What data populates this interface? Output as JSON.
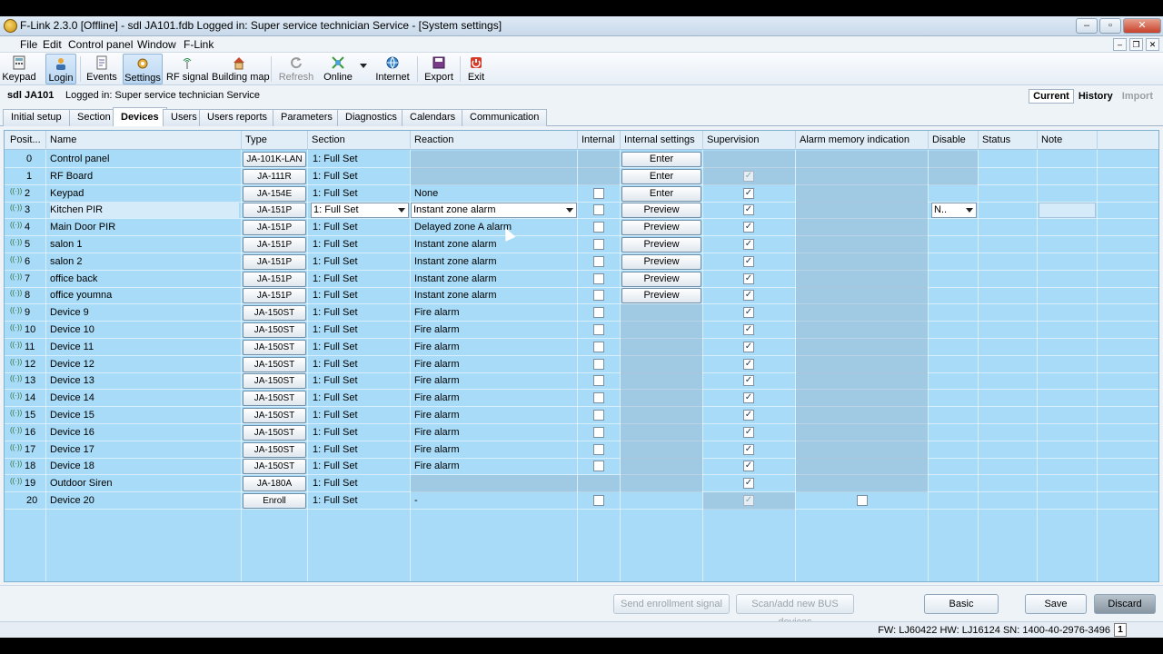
{
  "window": {
    "title": "F-Link 2.3.0 [Offline] - sdl JA101.fdb Logged in: Super service technician Service - [System settings]",
    "min": "–",
    "max": "▫",
    "close": "✕"
  },
  "menu": [
    "File",
    "Edit",
    "Control panel",
    "Window",
    "F-Link"
  ],
  "toolbar": [
    {
      "label": "Keypad",
      "icon": "keypad-icon"
    },
    {
      "label": "Login",
      "icon": "login-icon",
      "active": true
    },
    {
      "label": "Events",
      "icon": "events-icon"
    },
    {
      "label": "Settings",
      "icon": "settings-icon",
      "active": true
    },
    {
      "label": "RF signal",
      "icon": "rf-signal-icon"
    },
    {
      "label": "Building map",
      "icon": "building-map-icon"
    },
    {
      "label": "Refresh",
      "icon": "refresh-icon",
      "disabled": true
    },
    {
      "label": "Online",
      "icon": "online-icon"
    },
    {
      "label": "Internet",
      "icon": "internet-icon"
    },
    {
      "label": "Export",
      "icon": "export-icon"
    },
    {
      "label": "Exit",
      "icon": "exit-icon"
    }
  ],
  "info": {
    "site": "sdl JA101",
    "logged": "Logged in: Super service technician Service"
  },
  "view_tabs": [
    {
      "label": "Current",
      "state": "selected"
    },
    {
      "label": "History",
      "state": "normal"
    },
    {
      "label": "Import",
      "state": "disabled"
    }
  ],
  "tabs": [
    "Initial setup",
    "Section",
    "Devices",
    "Users",
    "Users reports",
    "Parameters",
    "Diagnostics",
    "Calendars",
    "Communication"
  ],
  "selected_tab": "Devices",
  "columns": [
    "Posit...",
    "Name",
    "Type",
    "Section",
    "Reaction",
    "Internal",
    "Internal settings",
    "Supervision",
    "Alarm memory indication",
    "Disable",
    "Status",
    "Note"
  ],
  "rows": [
    {
      "pos": "0",
      "name": "Control panel",
      "type": "JA-101K-LAN",
      "section": "1: Full Set",
      "reaction": "",
      "internal": "",
      "settings": "Enter",
      "supervision": "",
      "memory": "",
      "disable": "",
      "signal": false
    },
    {
      "pos": "1",
      "name": "RF Board",
      "type": "JA-111R",
      "section": "1: Full Set",
      "reaction": "",
      "internal": "",
      "settings": "Enter",
      "supervision": "dim",
      "memory": "",
      "disable": "",
      "signal": false
    },
    {
      "pos": "2",
      "name": "Keypad",
      "type": "JA-154E",
      "section": "1: Full Set",
      "reaction": "None",
      "internal": "box",
      "settings": "Enter",
      "supervision": "on",
      "memory": "",
      "disable": "",
      "signal": true
    },
    {
      "pos": "3",
      "name": "Kitchen PIR",
      "type": "JA-151P",
      "section": "1: Full Set",
      "reaction": "Instant zone alarm",
      "internal": "box",
      "settings": "Preview",
      "supervision": "on",
      "memory": "",
      "disable": "N..",
      "signal": true,
      "selected": true
    },
    {
      "pos": "4",
      "name": "Main Door PIR",
      "type": "JA-151P",
      "section": "1: Full Set",
      "reaction": "Delayed zone A alarm",
      "internal": "box",
      "settings": "Preview",
      "supervision": "on",
      "memory": "",
      "disable": "",
      "signal": true
    },
    {
      "pos": "5",
      "name": "salon 1",
      "type": "JA-151P",
      "section": "1: Full Set",
      "reaction": "Instant zone alarm",
      "internal": "box",
      "settings": "Preview",
      "supervision": "on",
      "memory": "",
      "disable": "",
      "signal": true
    },
    {
      "pos": "6",
      "name": "salon 2",
      "type": "JA-151P",
      "section": "1: Full Set",
      "reaction": "Instant zone alarm",
      "internal": "box",
      "settings": "Preview",
      "supervision": "on",
      "memory": "",
      "disable": "",
      "signal": true
    },
    {
      "pos": "7",
      "name": "office back",
      "type": "JA-151P",
      "section": "1: Full Set",
      "reaction": "Instant zone alarm",
      "internal": "box",
      "settings": "Preview",
      "supervision": "on",
      "memory": "",
      "disable": "",
      "signal": true
    },
    {
      "pos": "8",
      "name": "office youmna",
      "type": "JA-151P",
      "section": "1: Full Set",
      "reaction": "Instant zone alarm",
      "internal": "box",
      "settings": "Preview",
      "supervision": "on",
      "memory": "",
      "disable": "",
      "signal": true
    },
    {
      "pos": "9",
      "name": "Device 9",
      "type": "JA-150ST",
      "section": "1: Full Set",
      "reaction": "Fire alarm",
      "internal": "box",
      "settings": "",
      "supervision": "on",
      "memory": "",
      "disable": "",
      "signal": true
    },
    {
      "pos": "10",
      "name": "Device 10",
      "type": "JA-150ST",
      "section": "1: Full Set",
      "reaction": "Fire alarm",
      "internal": "box",
      "settings": "",
      "supervision": "on",
      "memory": "",
      "disable": "",
      "signal": true
    },
    {
      "pos": "11",
      "name": "Device 11",
      "type": "JA-150ST",
      "section": "1: Full Set",
      "reaction": "Fire alarm",
      "internal": "box",
      "settings": "",
      "supervision": "on",
      "memory": "",
      "disable": "",
      "signal": true
    },
    {
      "pos": "12",
      "name": "Device 12",
      "type": "JA-150ST",
      "section": "1: Full Set",
      "reaction": "Fire alarm",
      "internal": "box",
      "settings": "",
      "supervision": "on",
      "memory": "",
      "disable": "",
      "signal": true
    },
    {
      "pos": "13",
      "name": "Device 13",
      "type": "JA-150ST",
      "section": "1: Full Set",
      "reaction": "Fire alarm",
      "internal": "box",
      "settings": "",
      "supervision": "on",
      "memory": "",
      "disable": "",
      "signal": true
    },
    {
      "pos": "14",
      "name": "Device 14",
      "type": "JA-150ST",
      "section": "1: Full Set",
      "reaction": "Fire alarm",
      "internal": "box",
      "settings": "",
      "supervision": "on",
      "memory": "",
      "disable": "",
      "signal": true
    },
    {
      "pos": "15",
      "name": "Device 15",
      "type": "JA-150ST",
      "section": "1: Full Set",
      "reaction": "Fire alarm",
      "internal": "box",
      "settings": "",
      "supervision": "on",
      "memory": "",
      "disable": "",
      "signal": true
    },
    {
      "pos": "16",
      "name": "Device 16",
      "type": "JA-150ST",
      "section": "1: Full Set",
      "reaction": "Fire alarm",
      "internal": "box",
      "settings": "",
      "supervision": "on",
      "memory": "",
      "disable": "",
      "signal": true
    },
    {
      "pos": "17",
      "name": "Device 17",
      "type": "JA-150ST",
      "section": "1: Full Set",
      "reaction": "Fire alarm",
      "internal": "box",
      "settings": "",
      "supervision": "on",
      "memory": "",
      "disable": "",
      "signal": true
    },
    {
      "pos": "18",
      "name": "Device 18",
      "type": "JA-150ST",
      "section": "1: Full Set",
      "reaction": "Fire alarm",
      "internal": "box",
      "settings": "",
      "supervision": "on",
      "memory": "",
      "disable": "",
      "signal": true
    },
    {
      "pos": "19",
      "name": "Outdoor Siren",
      "type": "JA-180A",
      "section": "1: Full Set",
      "reaction": "",
      "internal": "",
      "settings": "",
      "supervision": "on",
      "memory": "",
      "disable": "",
      "signal": true
    },
    {
      "pos": "20",
      "name": "Device 20",
      "type": "Enroll",
      "section": "1: Full Set",
      "reaction": "-",
      "internal": "box",
      "settings": "",
      "supervision": "dim",
      "memory": "box",
      "disable": "",
      "signal": false
    }
  ],
  "bottom": {
    "send": "Send enrollment signal",
    "scan": "Scan/add new BUS devices",
    "basic": "Basic",
    "save": "Save",
    "discard": "Discard"
  },
  "status": {
    "fw": "FW: LJ60422 HW: LJ16124 SN: 1400-40-2976-3496",
    "page": "1"
  }
}
